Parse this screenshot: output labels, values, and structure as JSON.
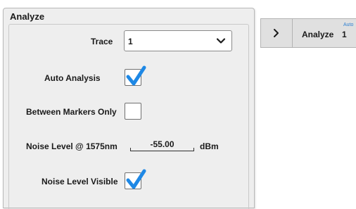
{
  "panel": {
    "title": "Analyze",
    "trace": {
      "label": "Trace",
      "value": "1"
    },
    "auto_analysis": {
      "label": "Auto Analysis",
      "checked": true
    },
    "between_markers_only": {
      "label": "Between Markers Only",
      "checked": false
    },
    "noise_level": {
      "label": "Noise Level @ 1575nm",
      "value": "-55.00",
      "unit": "dBm"
    },
    "noise_level_visible": {
      "label": "Noise Level Visible",
      "checked": true
    }
  },
  "softkey": {
    "label": "Analyze",
    "value": "1",
    "badge": "Auto",
    "arrow_icon": "chevron-right-icon"
  },
  "colors": {
    "check": "#1e88e5",
    "panel_bg": "#eeeeee",
    "softkey_bg": "#e0e0e0",
    "badge": "#2d7fd1"
  }
}
